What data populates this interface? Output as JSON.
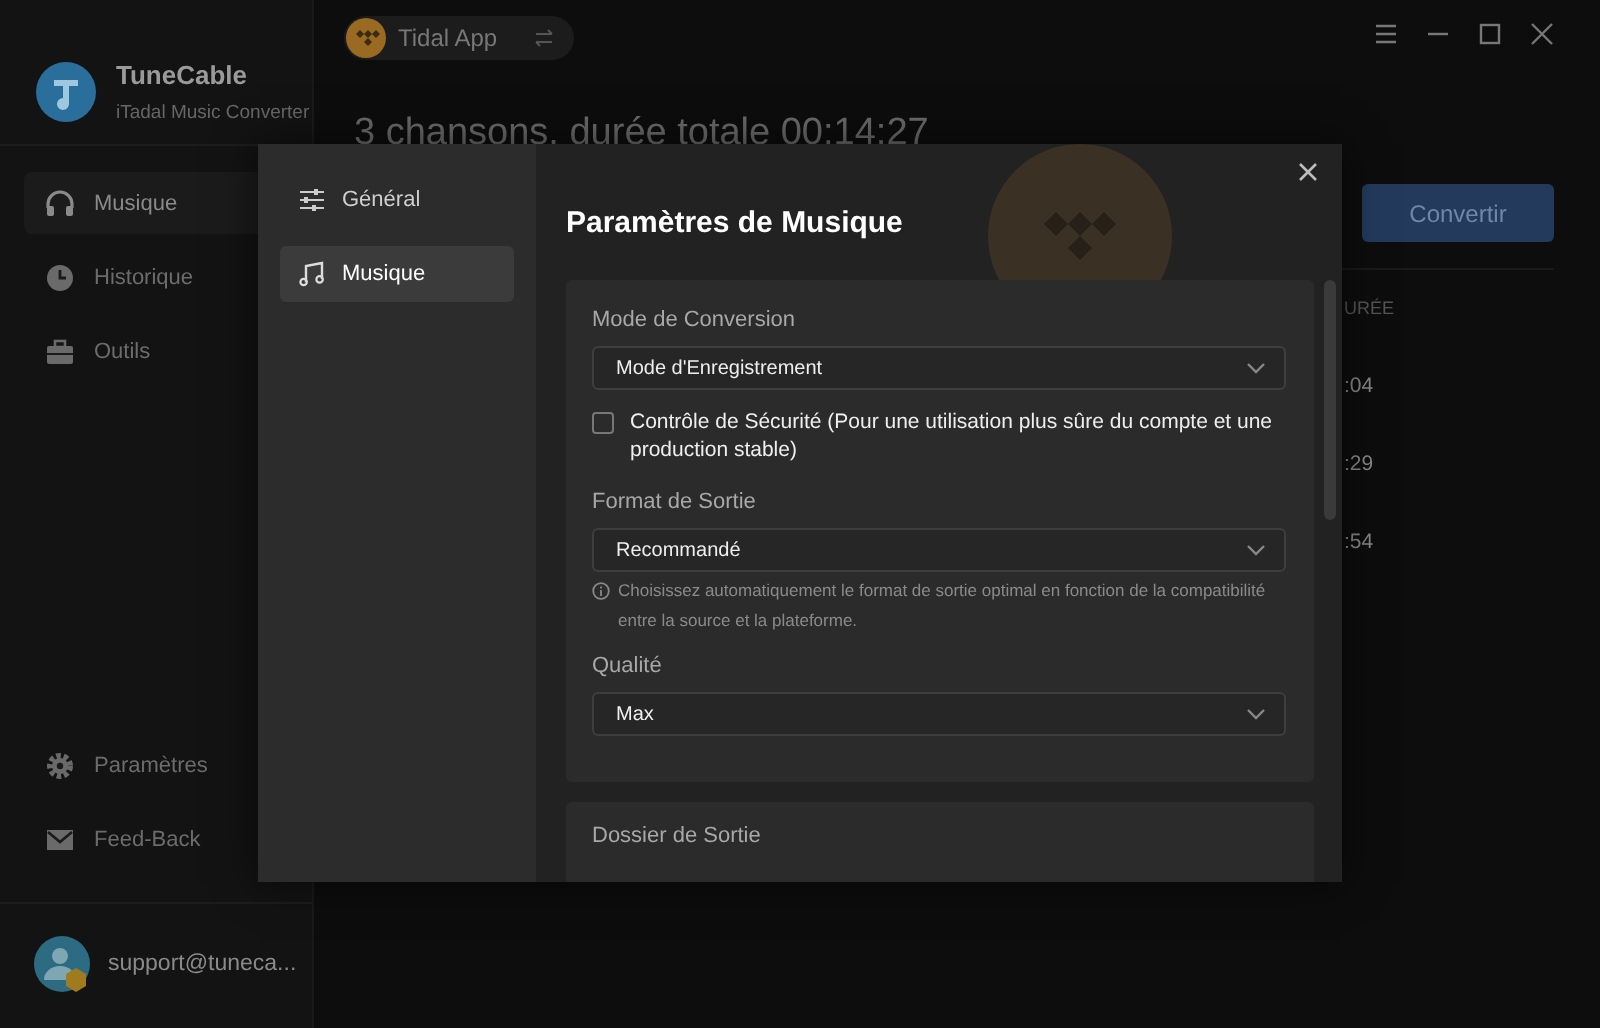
{
  "sidebar": {
    "brand": "TuneCable",
    "subtitle": "iTadal Music Converter",
    "nav": [
      {
        "label": "Musique",
        "selected": true
      },
      {
        "label": "Historique",
        "selected": false
      },
      {
        "label": "Outils",
        "selected": false
      }
    ],
    "bottom_nav": [
      {
        "label": "Paramètres"
      },
      {
        "label": "Feed-Back"
      }
    ],
    "account": {
      "email": "support@tuneca..."
    }
  },
  "source_selector": {
    "label": "Tidal App"
  },
  "summary": "3 chansons, durée totale 00:14:27",
  "convert_button": "Convertir",
  "table": {
    "columns": [
      "URÉE"
    ],
    "rows": [
      [
        ":04"
      ],
      [
        ":29"
      ],
      [
        ":54"
      ]
    ]
  },
  "dialog": {
    "nav": [
      {
        "label": "Général",
        "selected": false
      },
      {
        "label": "Musique",
        "selected": true
      }
    ],
    "title": "Paramètres de Musique",
    "sections": [
      {
        "fields": [
          {
            "kind": "select",
            "label": "Mode de Conversion",
            "value": "Mode d'Enregistrement"
          },
          {
            "kind": "checkbox",
            "label": "Contrôle de Sécurité (Pour une utilisation plus sûre du compte et une production stable)",
            "checked": false
          },
          {
            "kind": "select",
            "label": "Format de Sortie",
            "value": "Recommandé",
            "note": "Choisissez automatiquement le format de sortie optimal en fonction de la compatibilité entre la source et la plateforme."
          },
          {
            "kind": "select",
            "label": "Qualité",
            "value": "Max"
          }
        ]
      },
      {
        "fields": [
          {
            "kind": "heading",
            "label": "Dossier de Sortie"
          }
        ]
      }
    ]
  }
}
